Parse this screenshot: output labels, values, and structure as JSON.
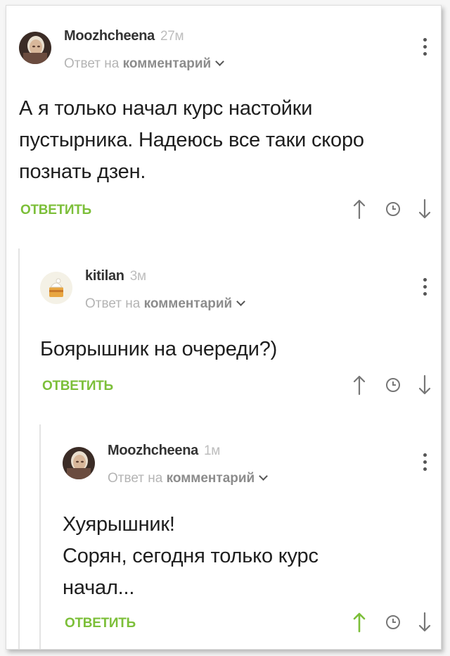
{
  "comments": [
    {
      "author": "Moozhcheena",
      "time": "27м",
      "reply_prefix": "Ответ на",
      "reply_target": "комментарий",
      "text_lines": [
        "А я только начал курс настойки",
        "пустырника. Надеюсь все таки скоро",
        "познать дзен."
      ],
      "reply_label": "ОТВЕТИТЬ",
      "upvoted": false
    },
    {
      "author": "kitilan",
      "time": "3м",
      "reply_prefix": "Ответ на",
      "reply_target": "комментарий",
      "text_lines": [
        "Боярышник на очереди?)"
      ],
      "reply_label": "ОТВЕТИТЬ",
      "upvoted": false
    },
    {
      "author": "Moozhcheena",
      "time": "1м",
      "reply_prefix": "Ответ на",
      "reply_target": "комментарий",
      "text_lines": [
        "Хуярышник!",
        "Сорян, сегодня только курс",
        "начал..."
      ],
      "reply_label": "ОТВЕТИТЬ",
      "upvoted": true
    }
  ],
  "colors": {
    "accent_green": "#7cbf39",
    "icon_grey": "#777777",
    "muted_text": "#b4b4b4"
  },
  "icons": [
    "more-vertical-icon",
    "chevron-down-icon",
    "upvote-arrow-icon",
    "clock-icon",
    "downvote-arrow-icon"
  ]
}
